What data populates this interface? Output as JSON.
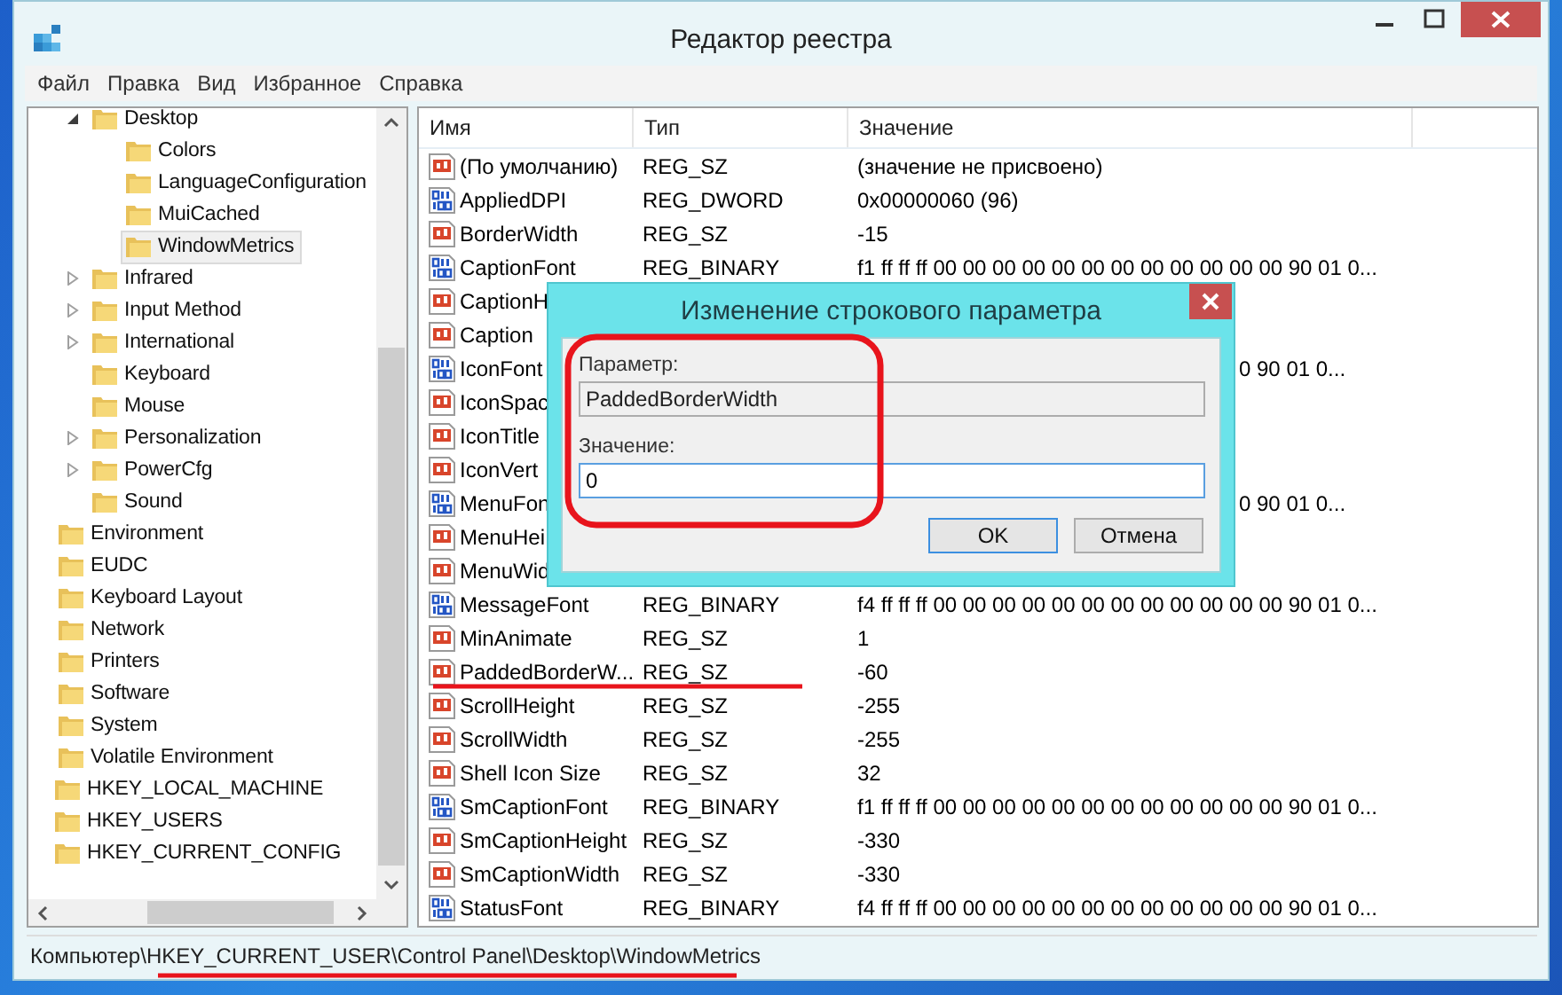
{
  "window": {
    "title": "Редактор реестра"
  },
  "menu": [
    "Файл",
    "Правка",
    "Вид",
    "Избранное",
    "Справка"
  ],
  "tree": {
    "items": [
      {
        "children": [
          {
            "children": [
              {
                "label": "Desktop",
                "expanded": true,
                "selected": false,
                "children": [
                  {
                    "label": "Colors",
                    "selected": false
                  },
                  {
                    "label": "LanguageConfiguration",
                    "selected": false
                  },
                  {
                    "label": "MuiCached",
                    "selected": false
                  },
                  {
                    "label": "WindowMetrics",
                    "selected": true
                  }
                ]
              },
              {
                "label": "Infrared",
                "expanded": false,
                "selected": false
              },
              {
                "label": "Input Method",
                "expanded": false,
                "selected": false
              },
              {
                "label": "International",
                "expanded": false,
                "selected": false
              },
              {
                "label": "Keyboard",
                "selected": false
              },
              {
                "label": "Mouse",
                "selected": false
              },
              {
                "label": "Personalization",
                "expanded": false,
                "selected": false
              },
              {
                "label": "PowerCfg",
                "expanded": false,
                "selected": false
              },
              {
                "label": "Sound",
                "selected": false
              }
            ]
          },
          {
            "label": "Environment",
            "selected": false
          },
          {
            "label": "EUDC",
            "selected": false
          },
          {
            "label": "Keyboard Layout",
            "selected": false
          },
          {
            "label": "Network",
            "selected": false
          },
          {
            "label": "Printers",
            "selected": false
          },
          {
            "label": "Software",
            "selected": false
          },
          {
            "label": "System",
            "selected": false
          },
          {
            "label": "Volatile Environment",
            "selected": false
          }
        ]
      },
      {
        "label": "HKEY_LOCAL_MACHINE",
        "selected": false
      },
      {
        "label": "HKEY_USERS",
        "selected": false
      },
      {
        "label": "HKEY_CURRENT_CONFIG",
        "selected": false
      }
    ]
  },
  "table": {
    "columns": [
      "Имя",
      "Тип",
      "Значение"
    ],
    "rows": [
      {
        "kind": "string",
        "name": "(По умолчанию)",
        "type": "REG_SZ",
        "value": "(значение не присвоено)"
      },
      {
        "kind": "binary",
        "name": "AppliedDPI",
        "type": "REG_DWORD",
        "value": "0x00000060 (96)"
      },
      {
        "kind": "string",
        "name": "BorderWidth",
        "type": "REG_SZ",
        "value": "-15"
      },
      {
        "kind": "binary",
        "name": "CaptionFont",
        "type": "REG_BINARY",
        "value": "f1 ff ff ff 00 00 00 00 00 00 00 00 00 00 00 00 90 01 0..."
      },
      {
        "kind": "string",
        "name": "CaptionH"
      },
      {
        "kind": "string",
        "name": "Caption"
      },
      {
        "kind": "binary",
        "name": "IconFont",
        "value": "0 90 01 0..."
      },
      {
        "kind": "string",
        "name": "IconSpac"
      },
      {
        "kind": "string",
        "name": "IconTitle"
      },
      {
        "kind": "string",
        "name": "IconVert"
      },
      {
        "kind": "binary",
        "name": "MenuFon",
        "value": "0 90 01 0..."
      },
      {
        "kind": "string",
        "name": "MenuHei"
      },
      {
        "kind": "string",
        "name": "MenuWid"
      },
      {
        "kind": "binary",
        "name": "MessageFont",
        "type": "REG_BINARY",
        "value": "f4 ff ff ff 00 00 00 00 00 00 00 00 00 00 00 00 90 01 0..."
      },
      {
        "kind": "string",
        "name": "MinAnimate",
        "type": "REG_SZ",
        "value": "1"
      },
      {
        "kind": "string",
        "name": "PaddedBorderW...",
        "type": "REG_SZ",
        "value": "-60"
      },
      {
        "kind": "string",
        "name": "ScrollHeight",
        "type": "REG_SZ",
        "value": "-255"
      },
      {
        "kind": "string",
        "name": "ScrollWidth",
        "type": "REG_SZ",
        "value": "-255"
      },
      {
        "kind": "string",
        "name": "Shell Icon Size",
        "type": "REG_SZ",
        "value": "32"
      },
      {
        "kind": "binary",
        "name": "SmCaptionFont",
        "type": "REG_BINARY",
        "value": "f1 ff ff ff 00 00 00 00 00 00 00 00 00 00 00 00 90 01 0..."
      },
      {
        "kind": "string",
        "name": "SmCaptionHeight",
        "type": "REG_SZ",
        "value": "-330"
      },
      {
        "kind": "string",
        "name": "SmCaptionWidth",
        "type": "REG_SZ",
        "value": "-330"
      },
      {
        "kind": "binary",
        "name": "StatusFont",
        "type": "REG_BINARY",
        "value": "f4 ff ff ff 00 00 00 00 00 00 00 00 00 00 00 00 90 01 0..."
      }
    ]
  },
  "status_bar": "Компьютер\\HKEY_CURRENT_USER\\Control Panel\\Desktop\\WindowMetrics",
  "dialog": {
    "title": "Изменение строкового параметра",
    "parameter_label": "Параметр:",
    "parameter": "PaddedBorderWidth",
    "value_label": "Значение:",
    "value": "0",
    "buttons": [
      "OK",
      "Отмена"
    ]
  }
}
